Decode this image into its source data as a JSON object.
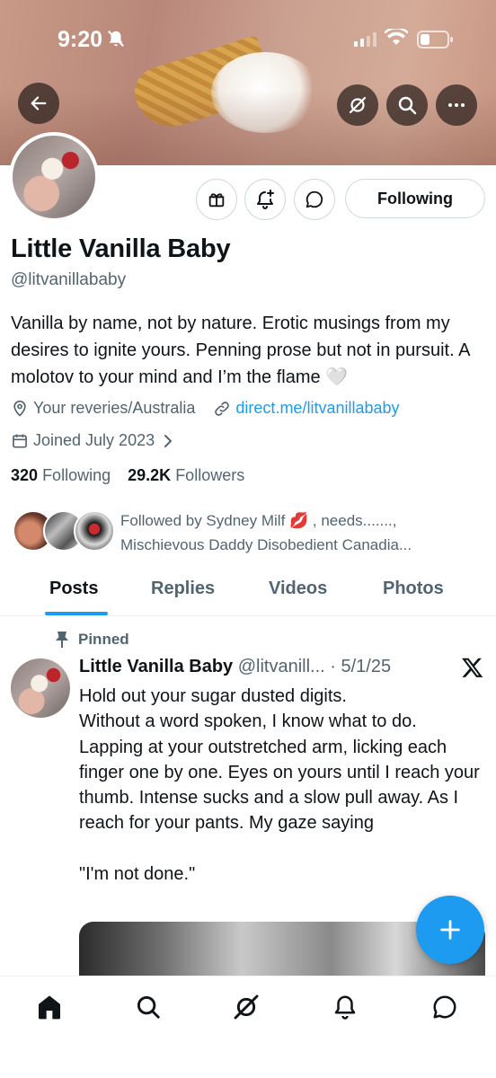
{
  "status_bar": {
    "time": "9:20"
  },
  "profile": {
    "name": "Little Vanilla Baby",
    "handle": "@litvanillababy",
    "bio": "Vanilla by name, not by nature. Erotic musings from my desires to ignite yours. Penning prose but not in pursuit. A molotov to your mind and I’m the flame 🤍",
    "location": "Your reveries/Australia",
    "website": "direct.me/litvanillababy",
    "joined": "Joined July 2023",
    "following_count": "320",
    "following_label": "Following",
    "followers_count": "29.2K",
    "followers_label": "Followers",
    "followed_by_line1": "Followed by Sydney Milf 💋 , needs.......,",
    "followed_by_line2": "Mischievous Daddy Disobedient Canadia..."
  },
  "actions": {
    "follow_state": "Following"
  },
  "tabs": [
    {
      "label": "Posts"
    },
    {
      "label": "Replies"
    },
    {
      "label": "Videos"
    },
    {
      "label": "Photos"
    }
  ],
  "pinned_post": {
    "pinned_label": "Pinned",
    "author": "Little Vanilla Baby",
    "meta": "@litvanill... · 5/1/25",
    "text": "Hold out your sugar dusted digits.\nWithout a word spoken, I know what to do. Lapping at your outstretched arm, licking each finger one by one. Eyes on yours until I reach your thumb. Intense sucks and a slow pull away. As I reach for your pants. My gaze saying\n\n\"I'm not done.\""
  },
  "colors": {
    "accent": "#1d9bf0",
    "text": "#0f1419",
    "muted": "#536471",
    "border": "#cfd9de"
  },
  "icons": [
    "back-arrow-icon",
    "grok-icon",
    "search-icon",
    "more-icon",
    "gift-icon",
    "notification-bell-plus-icon",
    "message-icon",
    "location-pin-icon",
    "link-icon",
    "calendar-icon",
    "chevron-right-icon",
    "pin-icon",
    "x-logo-icon",
    "compose-plus-icon",
    "home-icon",
    "bell-icon"
  ]
}
